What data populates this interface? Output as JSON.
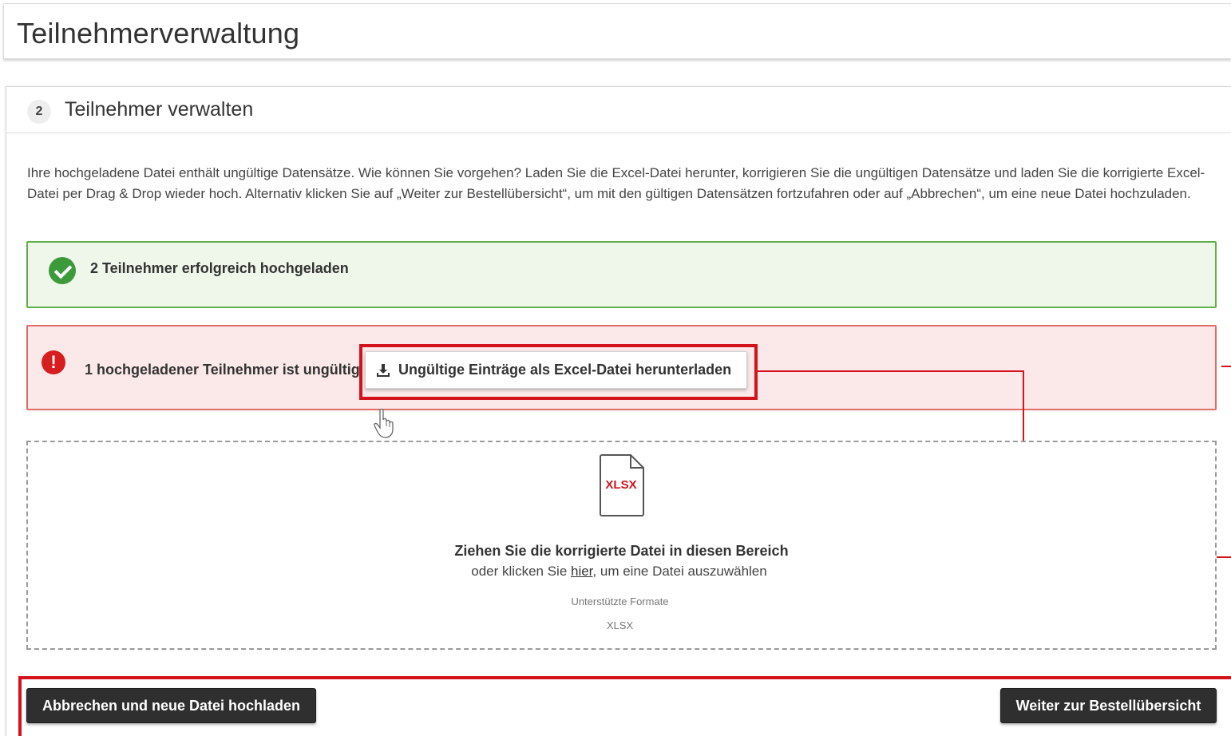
{
  "header": {
    "title": "Teilnehmerverwaltung"
  },
  "panel": {
    "step_number": "2",
    "title": "Teilnehmer verwalten"
  },
  "info_text": "Ihre hochgeladene Datei enthält ungültige Datensätze. Wie können Sie vorgehen? Laden Sie die Excel-Datei herunter, korrigieren Sie die ungültigen Datensätze und laden Sie die korrigierte Excel-Datei per Drag & Drop wieder hoch. Alternativ klicken Sie auf „Weiter zur Bestellübersicht“, um mit den gültigen Datensätzen fortzufahren oder auf „Abbrechen“, um eine neue Datei hochzuladen.",
  "success_alert": {
    "text": "2 Teilnehmer erfolgreich hochgeladen",
    "icon": "check-circle-icon"
  },
  "error_alert": {
    "text": "1 hochgeladener Teilnehmer ist ungültig",
    "icon": "exclamation-circle-icon",
    "download_button_label": "Ungültige Einträge als Excel-Datei herunterladen",
    "download_icon": "download-icon"
  },
  "dropzone": {
    "file_badge": "XLSX",
    "title": "Ziehen Sie die korrigierte Datei in diesen Bereich",
    "sub_prefix": "oder klicken Sie ",
    "sub_link": "hier",
    "sub_suffix": ", um eine Datei auszuwählen",
    "formats_label": "Unterstützte Formate",
    "formats_value": "XLSX"
  },
  "actions": {
    "cancel_label": "Abbrechen und neue Datei hochladen",
    "next_label": "Weiter zur Bestellübersicht"
  },
  "colors": {
    "highlight": "#d3121b",
    "success_border": "#5fb04a",
    "error_border": "#e06b6b",
    "button_dark": "#2f2f2f"
  }
}
